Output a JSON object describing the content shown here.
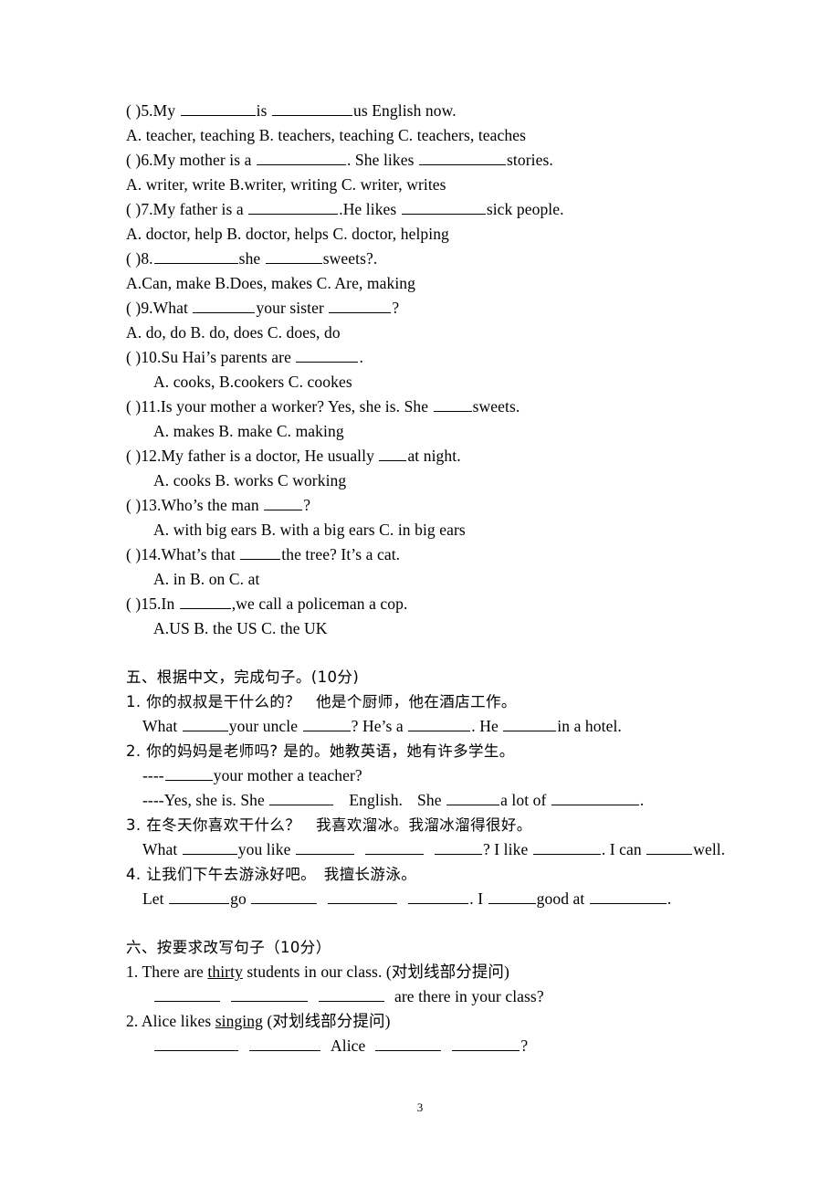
{
  "document": {
    "page_number": "3",
    "type": "english-exam-worksheet"
  },
  "multiple_choice": {
    "items": [
      {
        "marker": "(      )5.",
        "stem_a": "My ",
        "stem_b": "is ",
        "stem_c": "us English now.",
        "options": "A. teacher, teaching    B. teachers, teaching    C. teachers, teaches"
      },
      {
        "marker": "(      )6.",
        "stem_a": "My mother is a  ",
        "stem_b": ". She likes ",
        "stem_c": "stories.",
        "options": "A. writer, write   B.writer, writing    C. writer, writes"
      },
      {
        "marker": "(      )7.",
        "stem_a": "My father is a ",
        "stem_b": ".He likes ",
        "stem_c": "sick people.",
        "options": "A. doctor, help    B. doctor, helps    C. doctor, helping"
      },
      {
        "marker": "(      )8.",
        "stem_a": "",
        "stem_b": "she ",
        "stem_c": "sweets?.",
        "options": "A.Can, make B.Does, makes    C. Are, making"
      },
      {
        "marker": "(      )9.",
        "stem_a": "What ",
        "stem_b": "your sister ",
        "stem_c": "?",
        "options": "A. do, do   B. do, does   C. does, do"
      },
      {
        "marker": "(      )10.",
        "stem_a": "Su Hai’s parents are ",
        "stem_b": ".",
        "options": "A. cooks,   B.cookers   C. cookes"
      },
      {
        "marker": "(      )11.",
        "stem_a": "Is your mother a worker? Yes, she is. She ",
        "stem_b": "sweets.",
        "options": "A.  makes   B. make   C. making"
      },
      {
        "marker": "(      )12.",
        "stem_a": "My father is a doctor, He usually ",
        "stem_b": "at night.",
        "options": "A.  cooks   B. works   C working"
      },
      {
        "marker": "(      )13.",
        "stem_a": "Who’s the man ",
        "stem_b": "?",
        "options": "A.  with big ears   B. with a big ears   C. in big ears"
      },
      {
        "marker": "(      )14.",
        "stem_a": "What’s that ",
        "stem_b": "the tree? It’s a cat.",
        "options": "A.  in   B. on   C. at"
      },
      {
        "marker": "(      )15.",
        "stem_a": "In ",
        "stem_b": ",we call a policeman a cop.",
        "options": "A.US       B. the US       C. the UK"
      }
    ]
  },
  "section_five": {
    "heading": "五、根据中文，完成句子。(10分)",
    "questions": [
      {
        "chinese": "1. 你的叔叔是干什么的？　他是个厨师，他在酒店工作。",
        "en_1": "What ",
        "en_2": "your uncle ",
        "en_3": "? He’s a ",
        "en_4": ". He ",
        "en_5": "in a hotel."
      },
      {
        "chinese": "2. 你的妈妈是老师吗? 是的。她教英语，她有许多学生。",
        "ask_prefix": "----",
        "ask_suffix": "your mother a teacher?",
        "ans_1": "----Yes, she is. She ",
        "ans_2": "English.",
        "ans_3": "She ",
        "ans_4": "a lot of ",
        "ans_5": "."
      },
      {
        "chinese": "3. 在冬天你喜欢干什么？　我喜欢溜冰。我溜冰溜得很好。",
        "en_1": "What ",
        "en_2": "you like ",
        "en_3": "? I like ",
        "en_4": ". I can ",
        "en_5": "well."
      },
      {
        "chinese": "4. 让我们下午去游泳好吧。　我擅长游泳。",
        "en_1": "Let ",
        "en_2": "go ",
        "en_3": ". I ",
        "en_4": "good   at ",
        "en_5": "."
      }
    ]
  },
  "section_six": {
    "heading": "六、按要求改写句子（10分）",
    "questions": [
      {
        "prompt_a": "1. There are ",
        "prompt_underlined": "thirty",
        "prompt_b": " students in our class. (对划线部分提问)",
        "answer_tail": "are there in your class?"
      },
      {
        "prompt_a": "2. Alice likes ",
        "prompt_underlined": "singing",
        "prompt_b": " (对划线部分提问)",
        "answer_mid": "Alice",
        "answer_tail": "?"
      }
    ]
  }
}
